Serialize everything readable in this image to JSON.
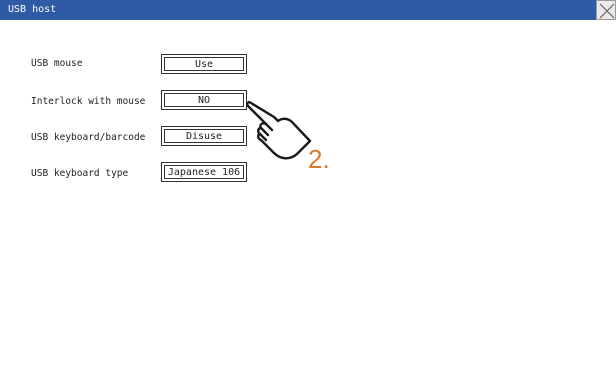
{
  "window": {
    "title": "USB host",
    "titlebar_color": "#2f5aa6"
  },
  "rows": [
    {
      "label": "USB mouse",
      "value": "Use"
    },
    {
      "label": "Interlock with mouse",
      "value": "NO"
    },
    {
      "label": "USB keyboard/barcode",
      "value": "Disuse"
    },
    {
      "label": "USB keyboard type",
      "value": "Japanese 106"
    }
  ],
  "annotation": {
    "step": "2.",
    "step_color": "#d97a2b",
    "pointer_icon": "hand-pointer-icon"
  }
}
